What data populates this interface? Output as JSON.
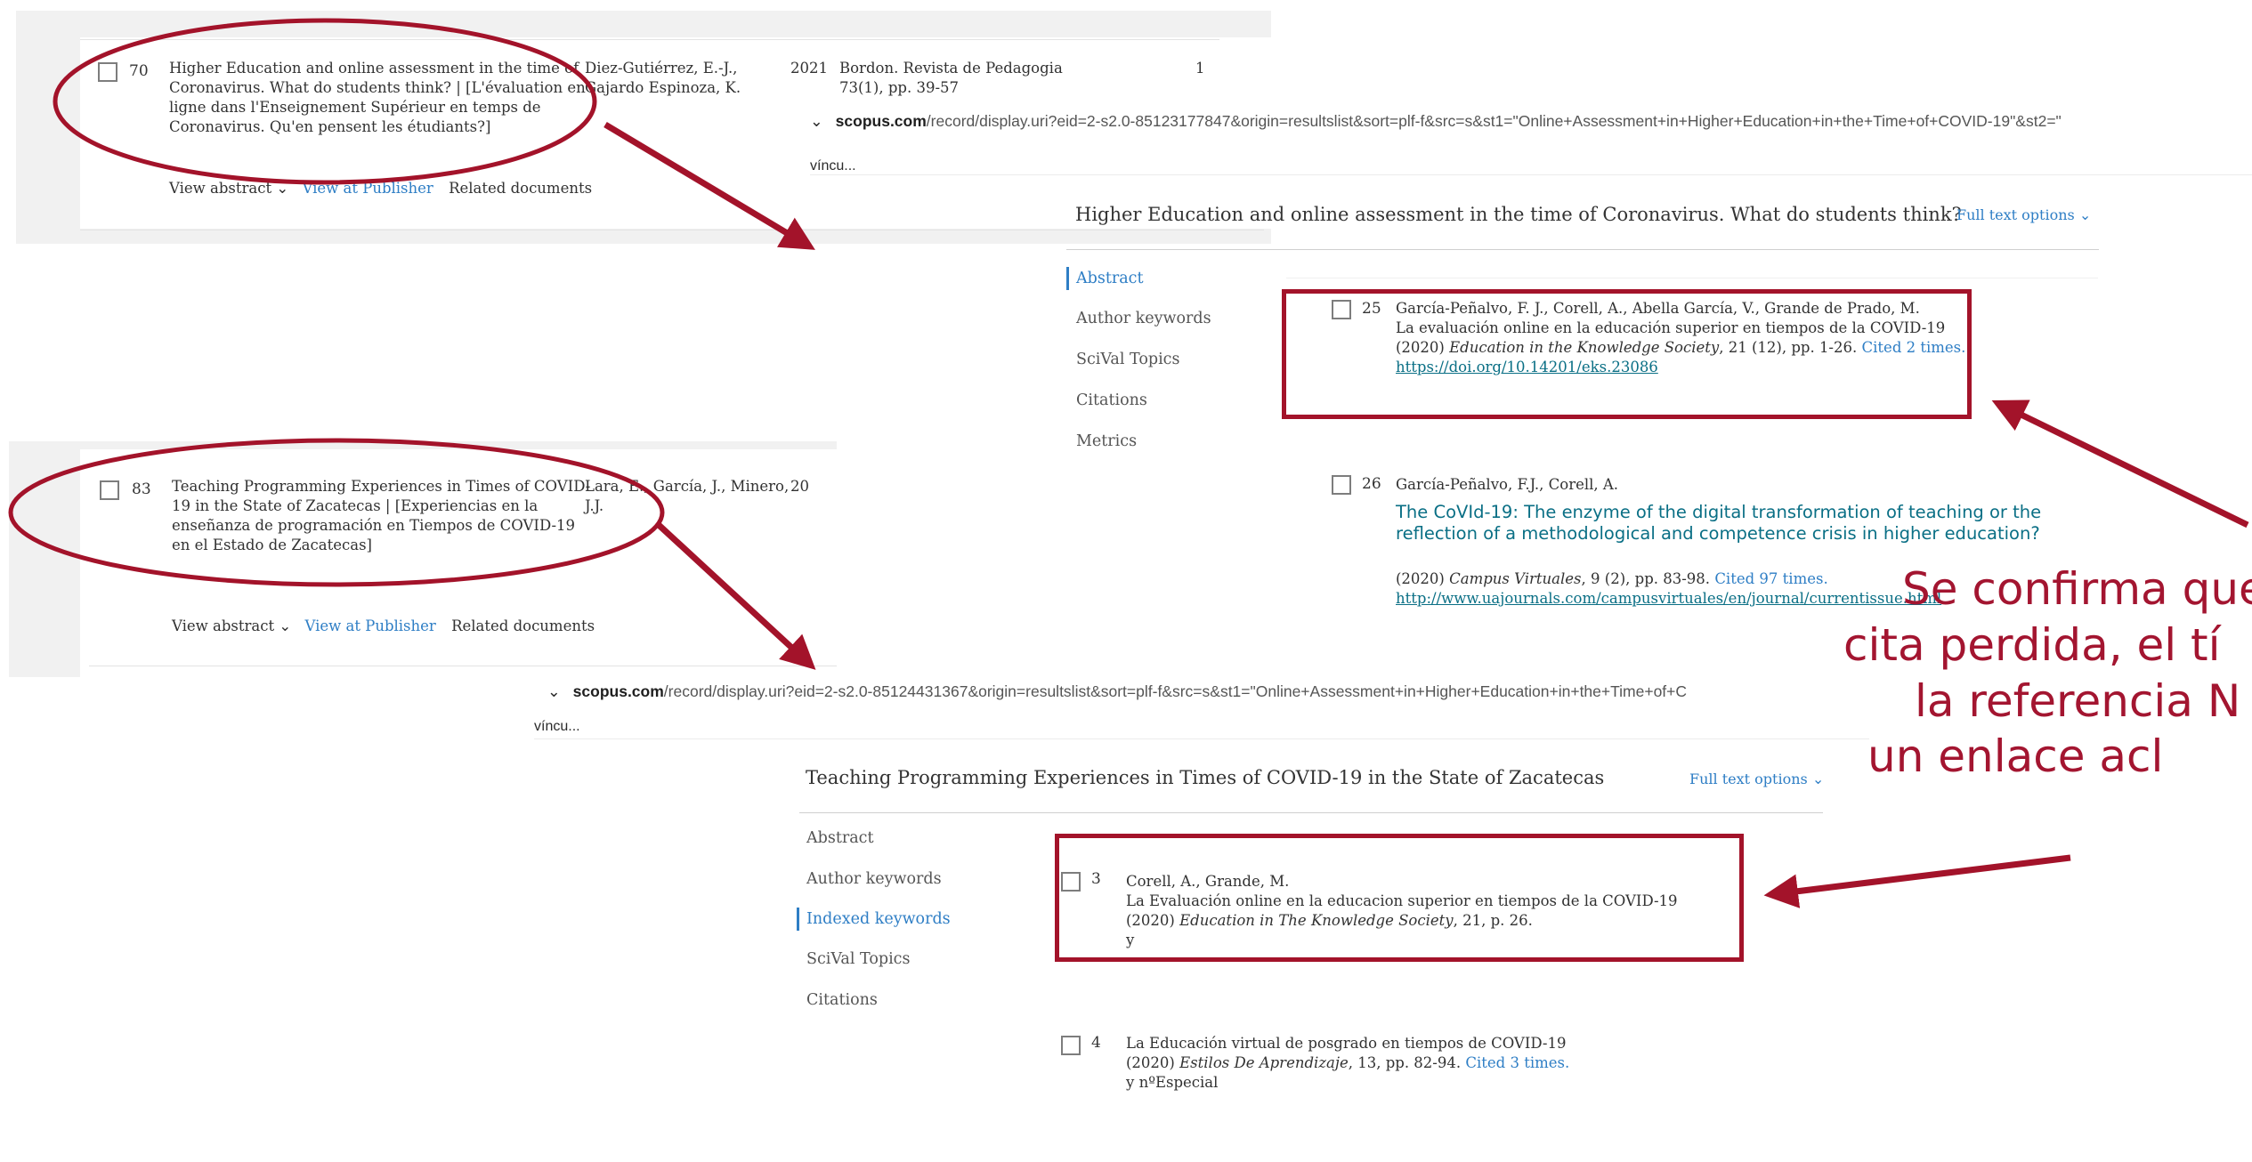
{
  "colors": {
    "accent_red": "#a3132a",
    "link_blue": "#2e7ec5",
    "link_teal": "#0a6f85"
  },
  "result_70": {
    "number": "70",
    "title_lines": [
      "Higher Education and online assessment in the time of",
      "Coronavirus. What do students think? | [L'évaluation en",
      "ligne dans l'Enseignement Supérieur en temps de",
      "Coronavirus. Qu'en pensent les étudiants?]"
    ],
    "authors_lines": [
      "Diez-Gutiérrez, E.-J.,",
      "Gajardo Espinoza, K."
    ],
    "year": "2021",
    "source_lines": [
      "Bordon. Revista de Pedagogia",
      "73(1), pp. 39-57"
    ],
    "cited": "1",
    "view_abstract": "View abstract",
    "view_publisher": "View at Publisher",
    "related": "Related documents"
  },
  "result_83": {
    "number": "83",
    "title_lines": [
      "Teaching Programming Experiences in Times of COVID-",
      "19 in the State of Zacatecas | [Experiencias en la",
      "enseñanza de programación en Tiempos de COVID-19",
      "en el Estado de Zacatecas]"
    ],
    "authors_lines": [
      "Lara, E., García, J., Minero,",
      "J.J."
    ],
    "year": "20",
    "view_abstract": "View abstract",
    "view_publisher": "View at Publisher",
    "related": "Related documents"
  },
  "record_1": {
    "url_domain": "scopus.com",
    "url_rest": "/record/display.uri?eid=2-s2.0-85123177847&origin=resultslist&sort=plf-f&src=s&st1=\"Online+Assessment+in+Higher+Education+in+the+Time+of+COVID-19\"&st2=\"",
    "vinculo": "víncu...",
    "title": "Higher Education and online assessment in the time of Coronavirus. What do students think?",
    "full_text_options": "Full text options",
    "sidebar": [
      "Abstract",
      "Author keywords",
      "SciVal Topics",
      "Citations",
      "Metrics"
    ],
    "ref_25": {
      "number": "25",
      "authors": "García-Peñalvo, F. J., Corell, A., Abella García, V., Grande de Prado, M.",
      "title": "La evaluación online en la educación superior en tiempos de la COVID-19",
      "year": "(2020)",
      "journal": "Education in the Knowledge Society",
      "details": ", 21 (12), pp. 1-26.",
      "cited": "Cited 2 times.",
      "doi": "https://doi.org/10.14201/eks.23086"
    },
    "ref_26": {
      "number": "26",
      "authors": "García-Peñalvo, F.J., Corell, A.",
      "title_lines": [
        "The CoVId-19: The enzyme of the digital transformation of teaching or the",
        "reflection of a methodological and competence crisis in higher education?"
      ],
      "year": "(2020)",
      "journal": "Campus Virtuales",
      "details": ", 9 (2), pp. 83-98.",
      "cited": "Cited 97 times.",
      "link": "http://www.uajournals.com/campusvirtuales/en/journal/currentissue.html"
    }
  },
  "record_2": {
    "url_domain": "scopus.com",
    "url_rest": "/record/display.uri?eid=2-s2.0-85124431367&origin=resultslist&sort=plf-f&src=s&st1=\"Online+Assessment+in+Higher+Education+in+the+Time+of+C",
    "vinculo": "víncu...",
    "title": "Teaching Programming Experiences in Times of COVID-19 in the State of Zacatecas",
    "full_text_options": "Full text options",
    "sidebar": [
      "Abstract",
      "Author keywords",
      "Indexed keywords",
      "SciVal Topics",
      "Citations"
    ],
    "ref_3": {
      "number": "3",
      "authors": "Corell, A., Grande, M.",
      "title": "La Evaluación online en la educacion superior en tiempos de la COVID-19",
      "year": "(2020)",
      "journal": "Education in The Knowledge Society",
      "details": ", 21, p. 26.",
      "extra": "y"
    },
    "ref_4": {
      "number": "4",
      "title": "La Educación virtual de posgrado en tiempos de COVID-19",
      "year": "(2020)",
      "journal": "Estilos De Aprendizaje",
      "details": ", 13, pp. 82-94.",
      "cited": "Cited 3 times.",
      "extra": "y nºEspecial"
    }
  },
  "caption_lines": [
    "Se confirma que",
    "cita perdida, el tí",
    "la referencia N",
    "un enlace acl"
  ]
}
